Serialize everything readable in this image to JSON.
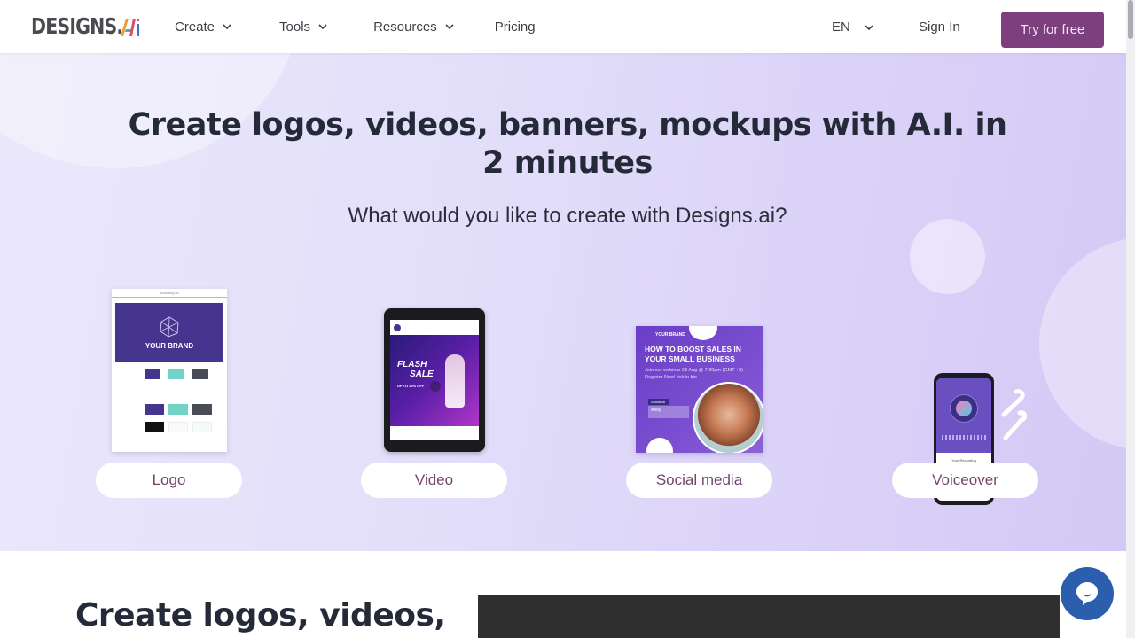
{
  "header": {
    "logo_text": "DESIGNS.",
    "logo_suffix": "AI",
    "nav": [
      {
        "label": "Create",
        "has_dropdown": true
      },
      {
        "label": "Tools",
        "has_dropdown": true
      },
      {
        "label": "Resources",
        "has_dropdown": true
      },
      {
        "label": "Pricing",
        "has_dropdown": false
      }
    ],
    "language": "EN",
    "sign_in": "Sign In",
    "cta": "Try for free"
  },
  "hero": {
    "title": "Create logos, videos, banners, mockups with A.I. in 2 minutes",
    "subtitle": "What would you like to create with Designs.ai?",
    "options": [
      {
        "label": "Logo",
        "preview_icon": "branding-kit-preview"
      },
      {
        "label": "Video",
        "preview_icon": "tablet-video-preview"
      },
      {
        "label": "Social media",
        "preview_icon": "social-post-preview"
      },
      {
        "label": "Voiceover",
        "preview_icon": "phone-voice-preview"
      }
    ],
    "previews": {
      "logo": {
        "header": "Branding kit",
        "brand": "YOUR BRAND"
      },
      "video": {
        "headline_1": "FLASH",
        "headline_2": "SALE",
        "tagline": "UP TO 30% OFF"
      },
      "social": {
        "brand": "YOUR BRAND",
        "headline": "HOW TO BOOST SALES IN YOUR SMALL BUSINESS",
        "body_1": "Join our webinar 28 Aug @ 7:30pm (GMT +8)",
        "body_2": "Register Now! link in bio",
        "speaker_label": "Speaker",
        "speaker_name": "Abby"
      },
      "voice": {
        "recording_label": "Your Recording"
      }
    }
  },
  "section2": {
    "title": "Create logos, videos,"
  },
  "colors": {
    "brand_purple": "#7d3f7d",
    "pill_text": "#74446f",
    "heading": "#242a38",
    "chat_blue": "#2b5fad"
  },
  "chat": {
    "icon": "chat-bubble-icon"
  }
}
